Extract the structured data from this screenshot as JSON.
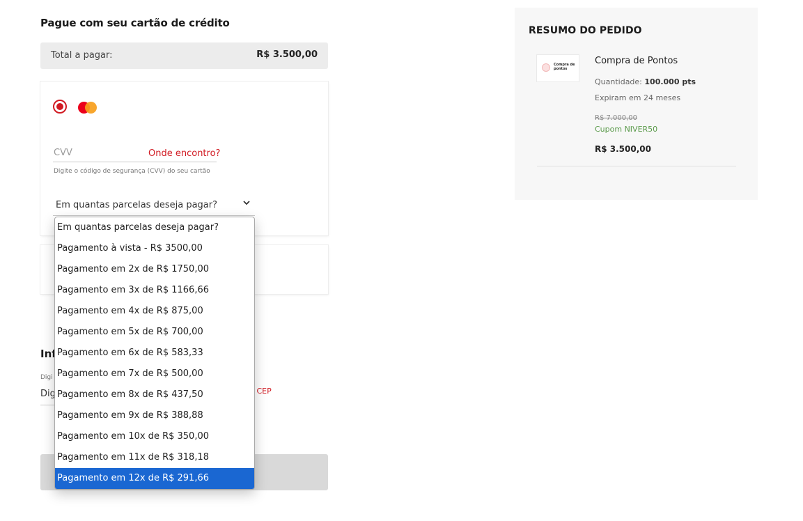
{
  "payment": {
    "title": "Pague com seu cartão de crédito",
    "total_label": "Total a pagar:",
    "total_value": "R$ 3.500,00",
    "card_brand_icon": "mastercard-icon",
    "cvv_placeholder": "CVV",
    "cvv_help_link": "Onde encontro?",
    "cvv_hint": "Digite o código de segurança (CVV) do seu cartão",
    "installments_select_label": "Em quantas parcelas deseja pagar?",
    "installment_options": [
      "Em quantas parcelas deseja pagar?",
      "Pagamento à vista - R$ 3500,00",
      "Pagamento em 2x de R$ 1750,00",
      "Pagamento em 3x de R$ 1166,66",
      "Pagamento em 4x de R$ 875,00",
      "Pagamento em 5x de R$ 700,00",
      "Pagamento em 6x de R$ 583,33",
      "Pagamento em 7x de R$ 500,00",
      "Pagamento em 8x de R$ 437,50",
      "Pagamento em 9x de R$ 388,88",
      "Pagamento em 10x de R$ 350,00",
      "Pagamento em 11x de R$ 318,18",
      "Pagamento em 12x de R$ 291,66"
    ],
    "highlighted_option_index": 12
  },
  "address": {
    "title_partial": "Inf",
    "hint_partial": "Digi",
    "input_partial": "Dig",
    "cep_link_partial": "u CEP"
  },
  "summary": {
    "title": "RESUMO DO PEDIDO",
    "thumb_text": "Compra de pontos",
    "product_name": "Compra de Pontos",
    "quantity_label": "Quantidade:",
    "quantity_value": "100.000 pts",
    "expiry": "Expiram em 24 meses",
    "old_price": "R$ 7.000,00",
    "coupon": "Cupom NIVER50",
    "new_price": "R$ 3.500,00"
  },
  "colors": {
    "accent_red": "#d11a22",
    "selected_blue": "#1a67d2",
    "coupon_green": "#5a9a4a"
  }
}
